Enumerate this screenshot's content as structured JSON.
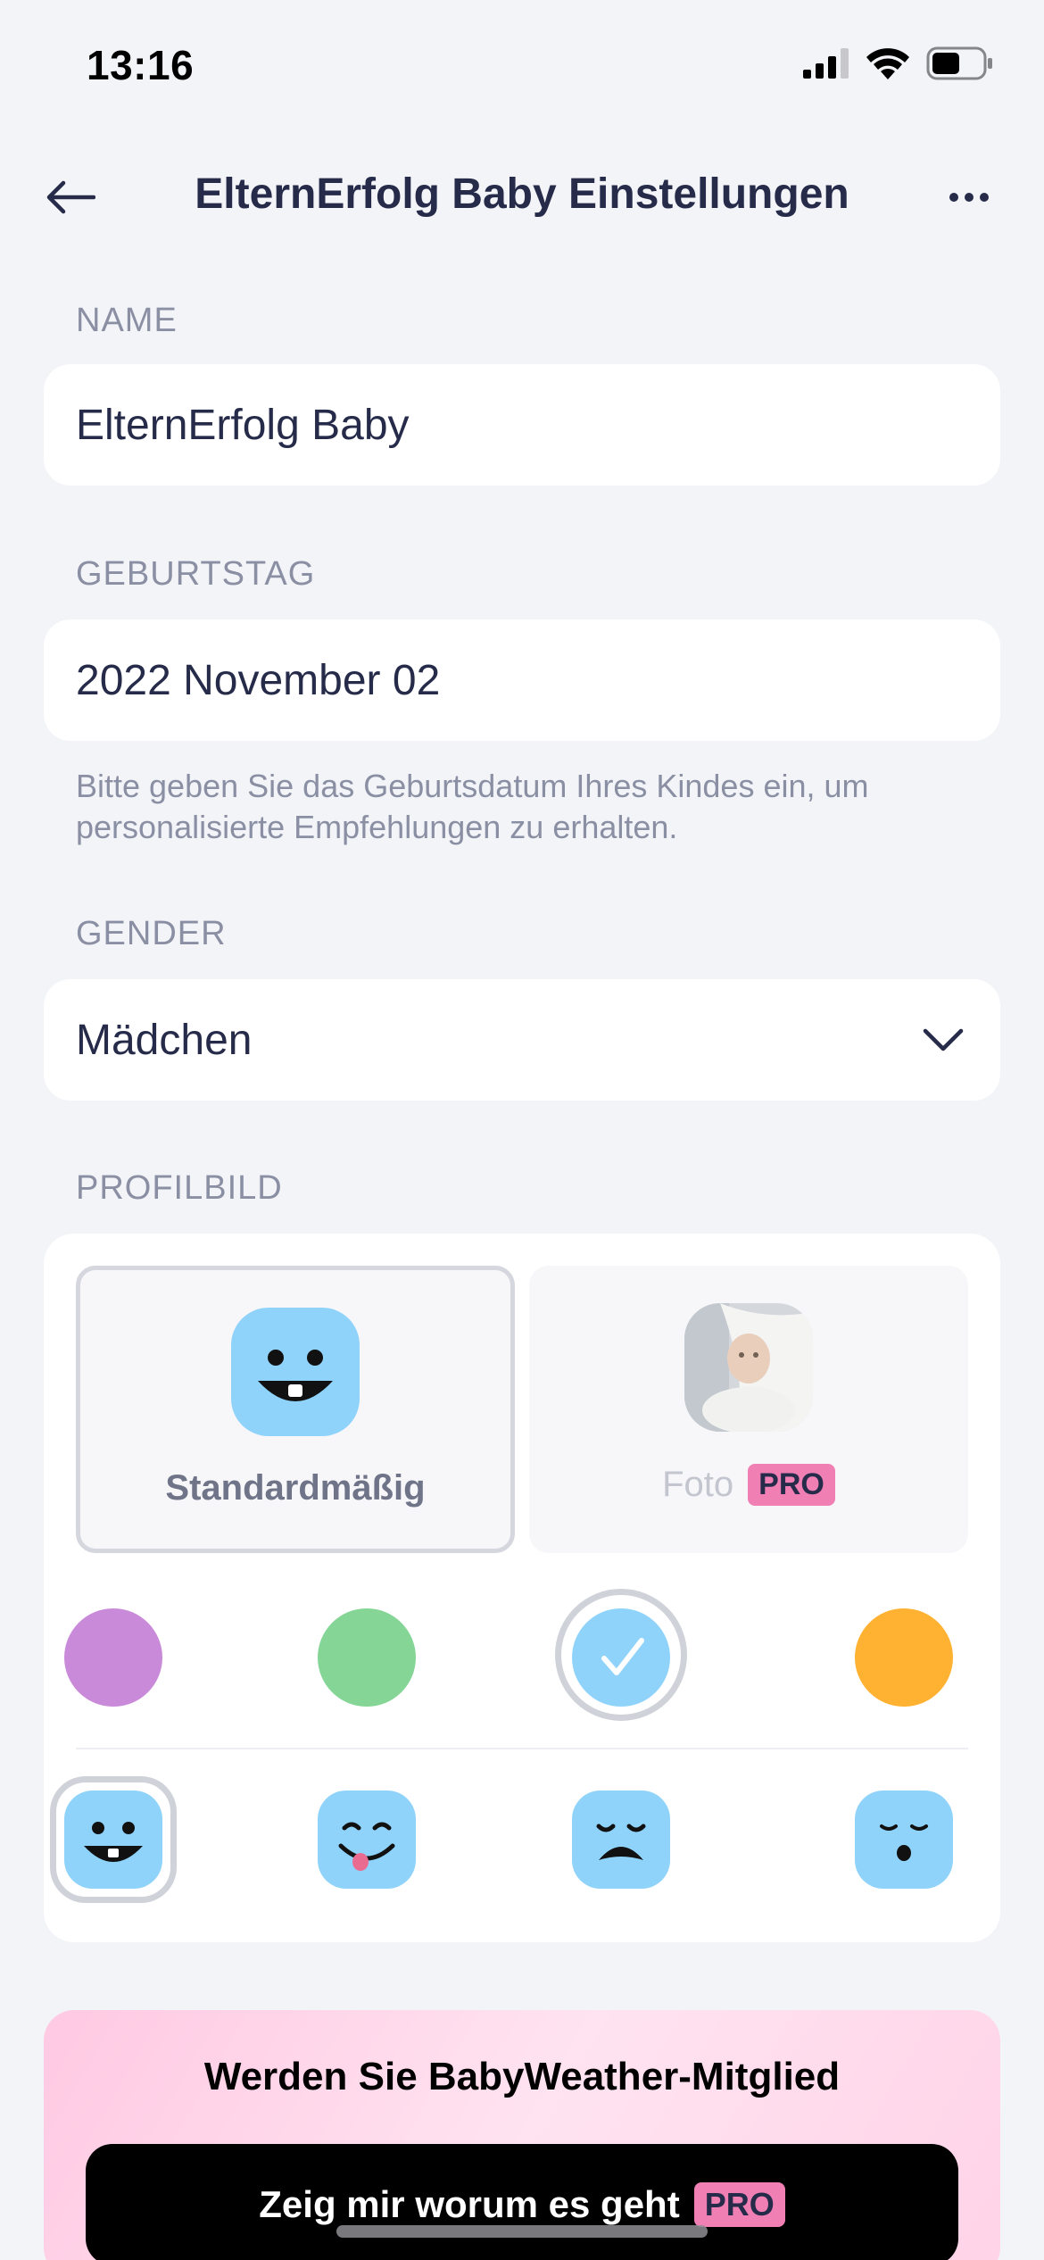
{
  "status_bar": {
    "time": "13:16",
    "battery_level": 0.55
  },
  "nav": {
    "title": "ElternErfolg Baby Einstellungen"
  },
  "name_section": {
    "label": "NAME",
    "value": "ElternErfolg Baby"
  },
  "birthday_section": {
    "label": "GEBURTSTAG",
    "value": "2022 November 02",
    "hint": "Bitte geben Sie das Geburtsdatum Ihres Kindes ein, um personalisierte Empfehlungen zu erhalten."
  },
  "gender_section": {
    "label": "GENDER",
    "value": "Mädchen"
  },
  "profile_section": {
    "label": "PROFILBILD",
    "default_option": "Standardmäßig",
    "photo_option": "Foto",
    "pro_badge": "PRO",
    "colors": [
      "#c98ad9",
      "#84d596",
      "#8fd3fb",
      "#ffb232"
    ],
    "selected_color_index": 2,
    "faces": [
      "smile-teeth-face",
      "tongue-out-face",
      "crying-face",
      "sleepy-face"
    ],
    "selected_face_index": 0
  },
  "promo": {
    "title": "Werden Sie BabyWeather-Mitglied",
    "button_label": "Zeig mir worum es geht",
    "pro_badge": "PRO"
  }
}
